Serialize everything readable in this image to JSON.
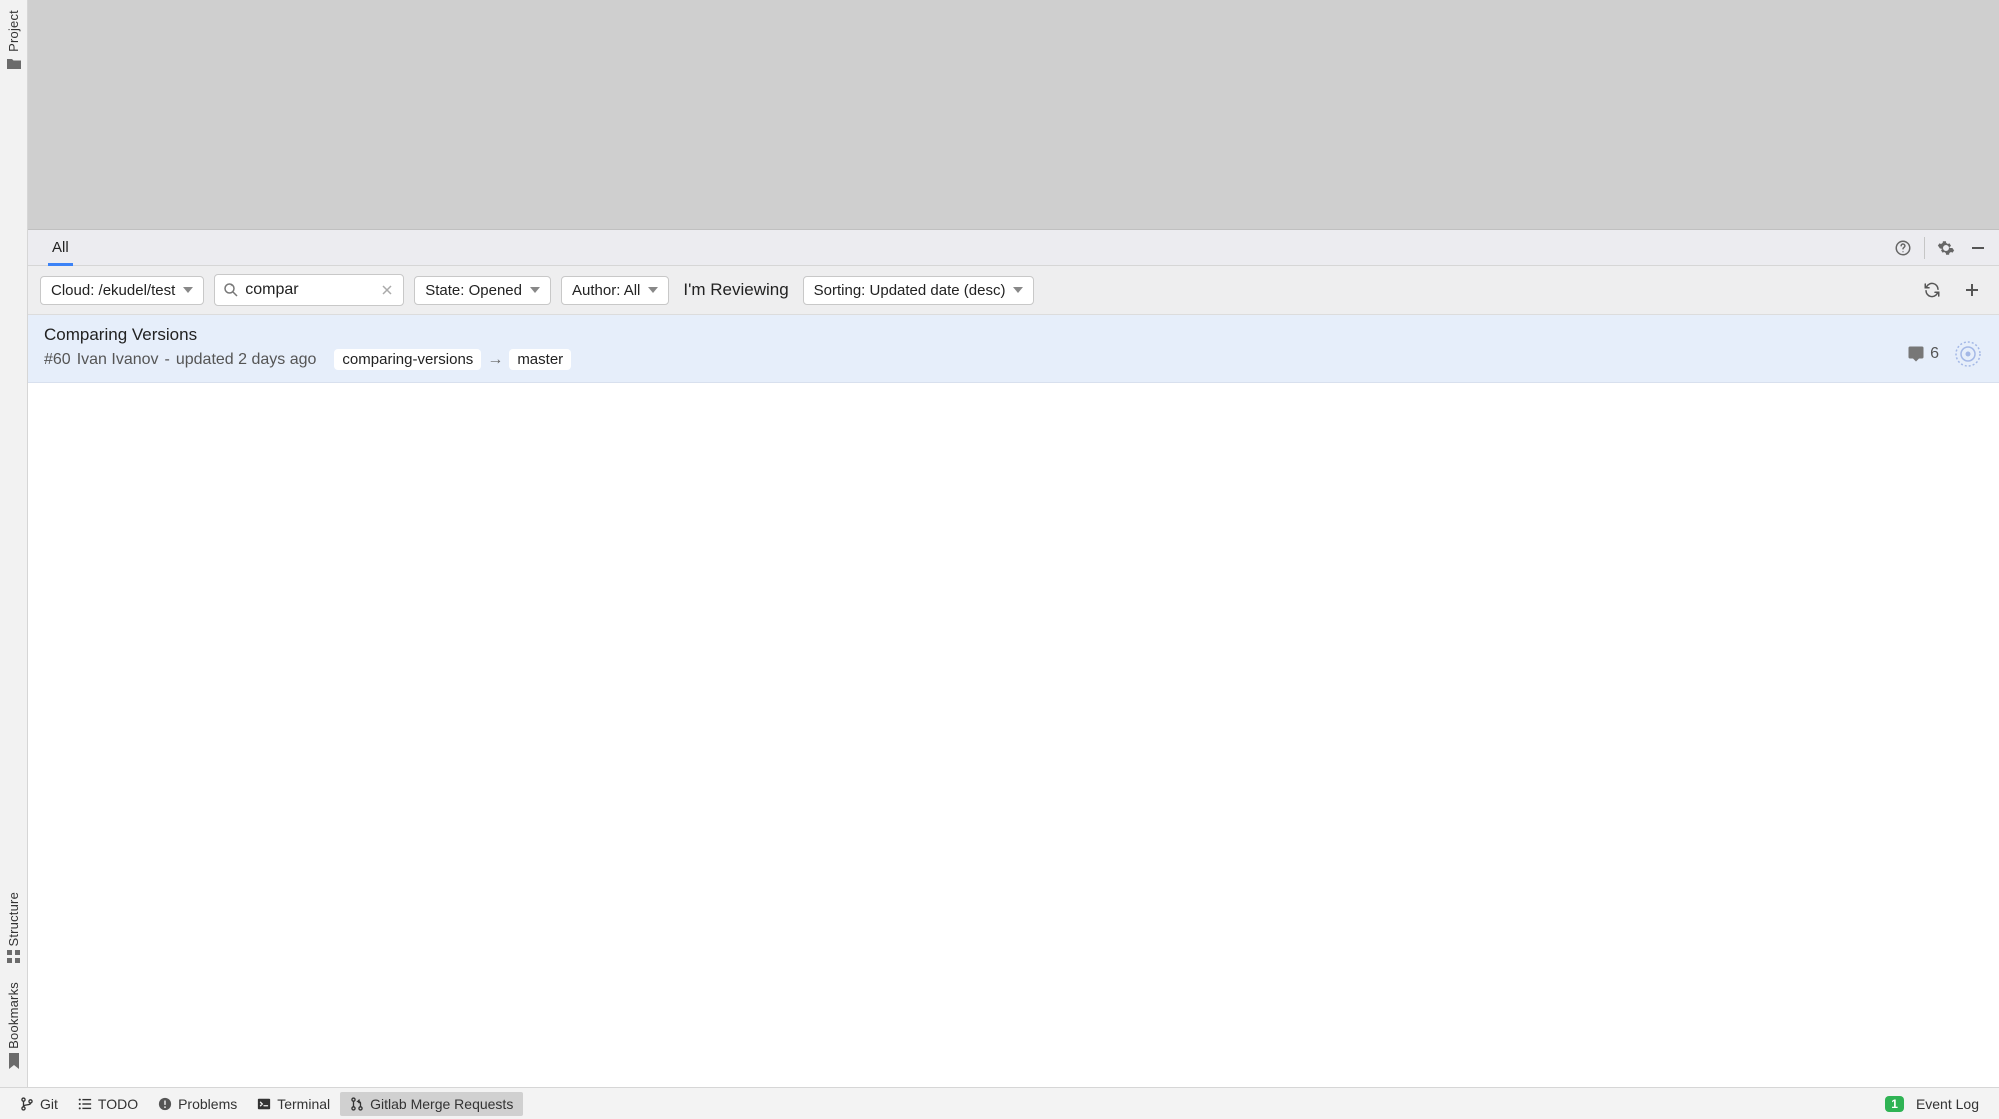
{
  "left_rail": {
    "project": "Project",
    "structure": "Structure",
    "bookmarks": "Bookmarks"
  },
  "panel": {
    "tabs": [
      {
        "label": "All",
        "active": true
      }
    ]
  },
  "toolbar": {
    "cloud_label": "Cloud: /ekudel/test",
    "search_value": "compar",
    "state_label": "State: Opened",
    "author_label": "Author: All",
    "reviewing_label": "I'm Reviewing",
    "sorting_label": "Sorting: Updated date (desc)"
  },
  "results": [
    {
      "title": "Comparing Versions",
      "id": "#60",
      "author": "Ivan Ivanov",
      "updated": "updated 2 days ago",
      "source_branch": "comparing-versions",
      "target_branch": "master",
      "comments": "6"
    }
  ],
  "status_bar": {
    "git": "Git",
    "todo": "TODO",
    "problems": "Problems",
    "terminal": "Terminal",
    "gitlab_mr": "Gitlab Merge Requests",
    "event_log_badge": "1",
    "event_log": "Event Log"
  }
}
